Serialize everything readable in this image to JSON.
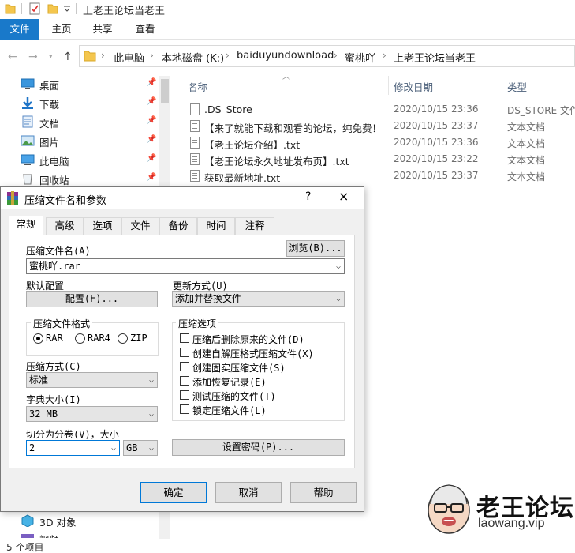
{
  "window": {
    "title": "上老王论坛当老王"
  },
  "ribbon": {
    "tabs": [
      "文件",
      "主页",
      "共享",
      "查看"
    ]
  },
  "address": {
    "crumbs": [
      "此电脑",
      "本地磁盘 (K:)",
      "baiduyundownload",
      "蜜桃吖",
      "上老王论坛当老王"
    ]
  },
  "nav": {
    "items": [
      {
        "label": "桌面",
        "icon": "desktop-icon",
        "pinned": true
      },
      {
        "label": "下载",
        "icon": "download-icon",
        "pinned": true
      },
      {
        "label": "文档",
        "icon": "documents-icon",
        "pinned": true
      },
      {
        "label": "图片",
        "icon": "pictures-icon",
        "pinned": true
      },
      {
        "label": "此电脑",
        "icon": "computer-icon",
        "pinned": true
      },
      {
        "label": "回收站",
        "icon": "recycle-bin-icon",
        "pinned": true
      }
    ],
    "bottom_items": [
      {
        "label": "3D 对象",
        "icon": "3d-objects-icon"
      },
      {
        "label": "视频",
        "icon": "videos-icon"
      }
    ]
  },
  "filelist": {
    "columns": {
      "name": "名称",
      "date": "修改日期",
      "type": "类型"
    },
    "rows": [
      {
        "name": ".DS_Store",
        "date": "2020/10/15 23:36",
        "type": "DS_STORE 文件",
        "icon": "file-icon"
      },
      {
        "name": "【来了就能下载和观看的论坛，纯免费！",
        "date": "2020/10/15 23:37",
        "type": "文本文档",
        "icon": "text-file-icon"
      },
      {
        "name": "【老王论坛介绍】.txt",
        "date": "2020/10/15 23:36",
        "type": "文本文档",
        "icon": "text-file-icon"
      },
      {
        "name": "【老王论坛永久地址发布页】.txt",
        "date": "2020/10/15 23:22",
        "type": "文本文档",
        "icon": "text-file-icon"
      },
      {
        "name": "获取最新地址.txt",
        "date": "2020/10/15 23:37",
        "type": "文本文档",
        "icon": "text-file-icon"
      }
    ]
  },
  "status": {
    "count": "5 个项目"
  },
  "dialog": {
    "title": "压缩文件名和参数",
    "help": "?",
    "close": "×",
    "tabs": [
      "常规",
      "高级",
      "选项",
      "文件",
      "备份",
      "时间",
      "注释"
    ],
    "archive_name_label": "压缩文件名(A)",
    "archive_name_value": "蜜桃吖.rar",
    "browse_label": "浏览(B)...",
    "default_profile_label": "默认配置",
    "profile_button": "配置(F)...",
    "update_mode_label": "更新方式(U)",
    "update_mode_value": "添加并替换文件",
    "format_group_label": "压缩文件格式",
    "formats": [
      "RAR",
      "RAR4",
      "ZIP"
    ],
    "format_selected": "RAR",
    "options_group_label": "压缩选项",
    "options": [
      "压缩后删除原来的文件(D)",
      "创建自解压格式压缩文件(X)",
      "创建固实压缩文件(S)",
      "添加恢复记录(E)",
      "测试压缩的文件(T)",
      "锁定压缩文件(L)"
    ],
    "method_label": "压缩方式(C)",
    "method_value": "标准",
    "dict_label": "字典大小(I)",
    "dict_value": "32 MB",
    "split_label": "切分为分卷(V)，大小",
    "split_value": "2",
    "split_unit": "GB",
    "password_button": "设置密码(P)...",
    "ok": "确定",
    "cancel": "取消",
    "help_button": "帮助"
  },
  "watermark": {
    "text": "老王论坛",
    "url": "laowang.vip"
  }
}
